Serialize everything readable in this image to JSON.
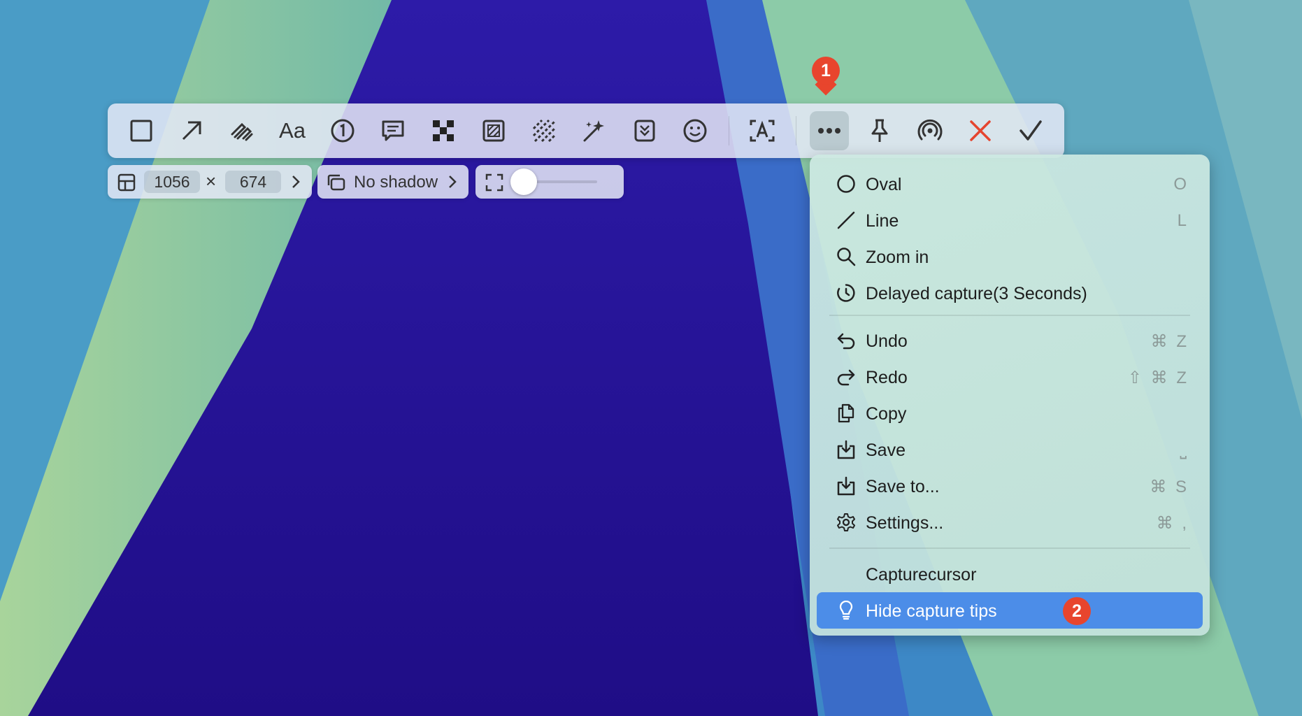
{
  "toolbar": {
    "tools": [
      {
        "icon": "rectangle-icon"
      },
      {
        "icon": "arrow-icon"
      },
      {
        "icon": "pen-icon"
      },
      {
        "icon": "text-icon",
        "label": "Aa"
      },
      {
        "icon": "counter-icon",
        "label": "1"
      },
      {
        "icon": "comment-icon"
      },
      {
        "icon": "pixelate-icon"
      },
      {
        "icon": "blur-icon"
      },
      {
        "icon": "hatch-icon"
      },
      {
        "icon": "magic-wand-icon"
      },
      {
        "icon": "chevrons-down-icon"
      },
      {
        "icon": "emoji-icon"
      },
      {
        "icon": "ocr-icon"
      },
      {
        "icon": "more-icon"
      },
      {
        "icon": "pin-icon"
      },
      {
        "icon": "broadcast-icon"
      },
      {
        "icon": "close-icon"
      },
      {
        "icon": "checkmark-icon"
      }
    ],
    "accent_close": "#e5452f"
  },
  "badges": {
    "step1": "1",
    "step2": "2",
    "color": "#e8452d"
  },
  "size": {
    "width": "1056",
    "height": "674",
    "times": "×"
  },
  "shadow": {
    "label": "No shadow"
  },
  "menu": {
    "items": [
      {
        "label": "Oval",
        "shortcut": "O",
        "icon": "oval-icon"
      },
      {
        "label": "Line",
        "shortcut": "L",
        "icon": "line-icon"
      },
      {
        "label": "Zoom in",
        "shortcut": "",
        "icon": "zoom-icon"
      },
      {
        "label": "Delayed capture(3 Seconds)",
        "shortcut": "",
        "icon": "timer-icon"
      },
      {
        "label": "Undo",
        "shortcut": "⌘ Z",
        "icon": "undo-icon"
      },
      {
        "label": "Redo",
        "shortcut": "⇧ ⌘ Z",
        "icon": "redo-icon"
      },
      {
        "label": "Copy",
        "shortcut": "",
        "icon": "copy-icon"
      },
      {
        "label": "Save",
        "shortcut": "⎵",
        "icon": "save-icon"
      },
      {
        "label": "Save to...",
        "shortcut": "⌘ S",
        "icon": "save-to-icon"
      },
      {
        "label": "Settings...",
        "shortcut": "⌘ ,",
        "icon": "gear-icon"
      },
      {
        "label": "Capturecursor",
        "shortcut": ""
      },
      {
        "label": "Hide capture tips",
        "shortcut": "",
        "icon": "lightbulb-icon"
      }
    ],
    "highlight_color": "#4c8de8"
  }
}
